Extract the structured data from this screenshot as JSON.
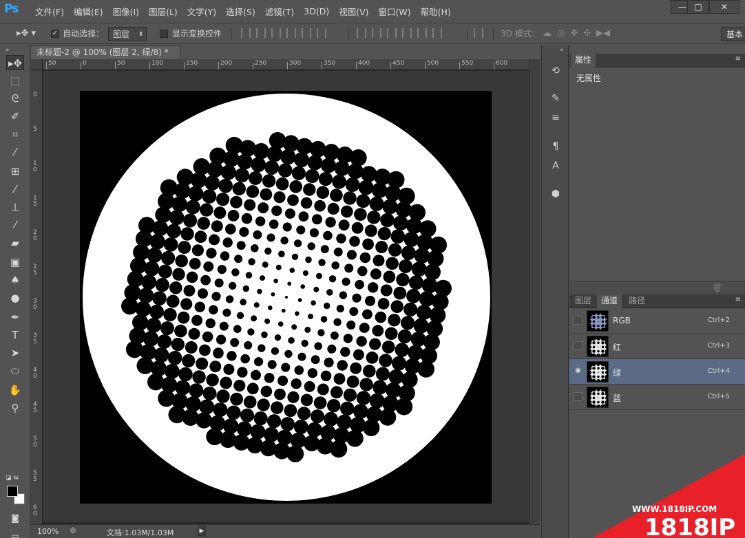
{
  "app": {
    "logo": "Ps",
    "window_buttons": {
      "minimize": "—",
      "maximize": "□",
      "close": "✕"
    }
  },
  "menu": [
    "文件(F)",
    "编辑(E)",
    "图像(I)",
    "图层(L)",
    "文字(Y)",
    "选择(S)",
    "滤镜(T)",
    "3D(D)",
    "视图(V)",
    "窗口(W)",
    "帮助(H)"
  ],
  "options": {
    "auto_select_label": "自动选择：",
    "auto_select_value": "图层",
    "show_transform_label": "显示变换控件",
    "mode_3d_label": "3D 模式：",
    "workspace": "基本"
  },
  "tools": [
    "move-icon",
    "marquee-icon",
    "lasso-icon",
    "quick-select-icon",
    "crop-icon",
    "eyedropper-icon",
    "heal-icon",
    "brush-icon",
    "stamp-icon",
    "history-brush-icon",
    "eraser-icon",
    "gradient-icon",
    "blur-icon",
    "dodge-icon",
    "pen-icon",
    "type-icon",
    "path-select-icon",
    "shape-icon",
    "hand-icon",
    "zoom-icon"
  ],
  "document": {
    "tab_title": "未标题-2 @ 100% (图层 2, 绿/8) *",
    "close": "×",
    "zoom": "100%",
    "doc_info": "文档:1.03M/1.03M"
  },
  "rulers": {
    "top": [
      "50",
      "0",
      "50",
      "100",
      "150",
      "200",
      "250",
      "300",
      "350",
      "400",
      "450",
      "500",
      "550",
      "600"
    ],
    "left": [
      "0",
      "5",
      "1 0",
      "1 5",
      "2 0",
      "2 5",
      "3 0",
      "3 5",
      "4 0",
      "4 5",
      "5 0",
      "5 5",
      "6 0"
    ]
  },
  "properties": {
    "tab": "属性",
    "content": "无属性"
  },
  "channels": {
    "tabs": [
      "图层",
      "通道",
      "路径"
    ],
    "active_tab": "通道",
    "rows": [
      {
        "name": "RGB",
        "shortcut": "Ctrl+2",
        "visible": false,
        "selected": false
      },
      {
        "name": "红",
        "shortcut": "Ctrl+3",
        "visible": false,
        "selected": false
      },
      {
        "name": "绿",
        "shortcut": "Ctrl+4",
        "visible": true,
        "selected": true
      },
      {
        "name": "蓝",
        "shortcut": "Ctrl+5",
        "visible": false,
        "selected": false
      }
    ]
  },
  "watermark": {
    "url": "WWW.1818IP.COM",
    "brand": "1818IP"
  },
  "colors": {
    "accent": "#31a8ff",
    "selection": "#5b6b86",
    "watermark": "#e8202a"
  }
}
